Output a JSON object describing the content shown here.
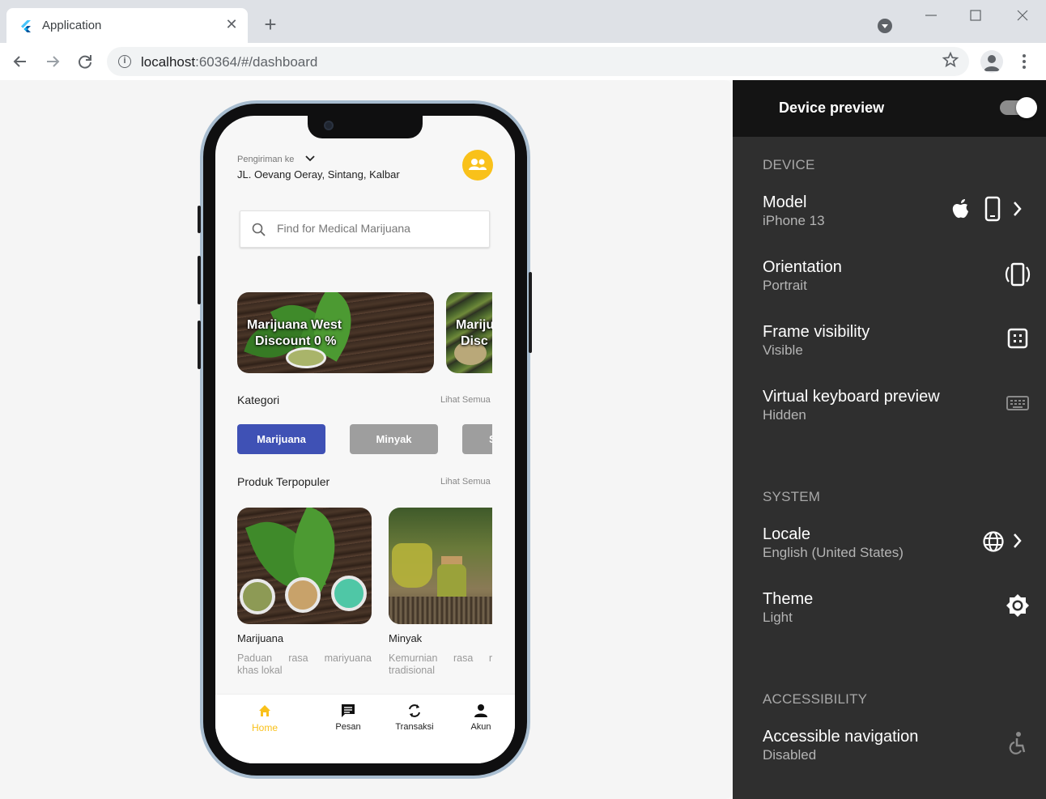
{
  "browser": {
    "tab_title": "Application",
    "url_host": "localhost",
    "url_path": ":60364/#/dashboard"
  },
  "app": {
    "deliver_label": "Pengiriman ke",
    "deliver_address": "JL. Oevang Oeray, Sintang, Kalbar",
    "search_placeholder": "Find for Medical Marijuana",
    "banners": [
      {
        "line1": "Marijuana West",
        "line2": "Discount 0 %"
      },
      {
        "line1": "Mariju",
        "line2": "Disc"
      }
    ],
    "categories_title": "Kategori",
    "see_all": "Lihat Semua",
    "categories": [
      {
        "label": "Marijuana",
        "color": "#3f51b5"
      },
      {
        "label": "Minyak",
        "color": "#9e9e9e"
      },
      {
        "label": "S",
        "color": "#9e9e9e"
      }
    ],
    "popular_title": "Produk Terpopuler",
    "products": [
      {
        "name": "Marijuana",
        "desc_line1": "Paduan rasa mariyuana",
        "desc_line2": "khas lokal"
      },
      {
        "name": "Minyak",
        "desc_line1": "Kemurnian rasa r",
        "desc_line2": "tradisional"
      }
    ],
    "bottom_nav": [
      {
        "label": "Home",
        "icon": "home-icon"
      },
      {
        "label": "Pesan",
        "icon": "chat-icon"
      },
      {
        "label": "Transaksi",
        "icon": "sync-icon"
      },
      {
        "label": "Akun",
        "icon": "person-icon"
      }
    ],
    "accent_color": "#f9c11a"
  },
  "device_preview": {
    "title": "Device preview",
    "enabled": true,
    "sections": {
      "device": "DEVICE",
      "system": "SYSTEM",
      "accessibility": "ACCESSIBILITY"
    },
    "model": {
      "title": "Model",
      "value": "iPhone 13"
    },
    "orientation": {
      "title": "Orientation",
      "value": "Portrait"
    },
    "frame": {
      "title": "Frame visibility",
      "value": "Visible"
    },
    "keyboard": {
      "title": "Virtual keyboard preview",
      "value": "Hidden"
    },
    "locale": {
      "title": "Locale",
      "value": "English (United States)"
    },
    "theme": {
      "title": "Theme",
      "value": "Light"
    },
    "accessible_nav": {
      "title": "Accessible navigation",
      "value": "Disabled"
    }
  }
}
